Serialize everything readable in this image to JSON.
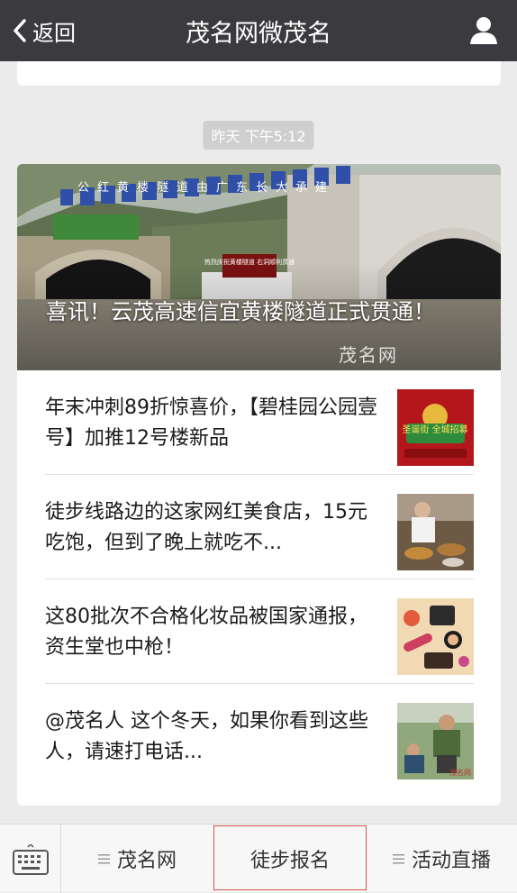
{
  "nav": {
    "back_label": "返回",
    "title": "茂名网微茂名"
  },
  "chat": {
    "timestamp": "昨天 下午5:12"
  },
  "news": {
    "cover": {
      "title": "喜讯！云茂高速信宜黄楼隧道正式贯通！",
      "banner_text": "公红黄楼隧道由广东长大承建",
      "sign_text": "热烈庆祝黄楼隧道 右洞顺利贯通",
      "watermark": "茂名网"
    },
    "items": [
      {
        "text": "年末冲刺89折惊喜价，【碧桂园公园壹号】加推12号楼新品",
        "thumb_text": "圣诞街 全城招募"
      },
      {
        "text": "徒步线路边的这家网红美食店，15元吃饱，但到了晚上就吃不..."
      },
      {
        "text": "这80批次不合格化妆品被国家通报，资生堂也中枪！"
      },
      {
        "text": "@茂名人 这个冬天，如果你看到这些人，请速打电话...",
        "thumb_text": "茂名网"
      }
    ]
  },
  "menu": {
    "items": [
      "茂名网",
      "徒步报名",
      "活动直播"
    ]
  },
  "colors": {
    "nav_bg": "#3b3b3f",
    "page_bg": "#ebebeb",
    "highlight": "#d9534f"
  }
}
